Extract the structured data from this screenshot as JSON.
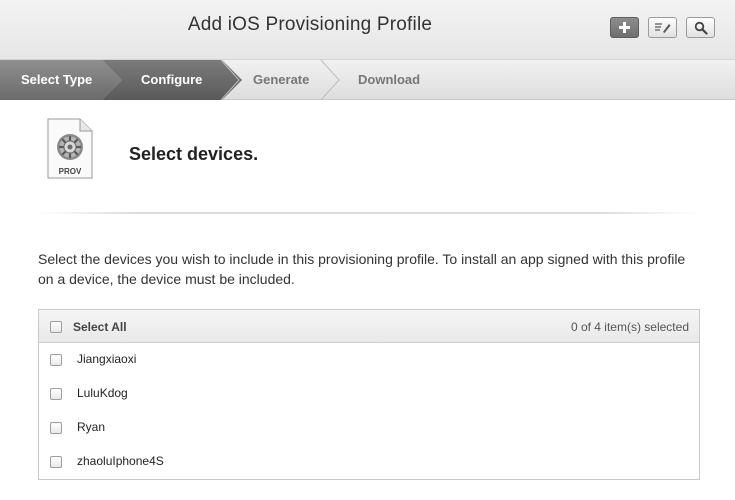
{
  "header": {
    "title": "Add iOS Provisioning Profile",
    "buttons": [
      {
        "icon": "plus-icon"
      },
      {
        "icon": "edit-icon"
      },
      {
        "icon": "search-icon"
      }
    ]
  },
  "steps": [
    {
      "label": "Select Type",
      "state": "completed"
    },
    {
      "label": "Configure",
      "state": "active"
    },
    {
      "label": "Generate",
      "state": "pending"
    },
    {
      "label": "Download",
      "state": "pending"
    }
  ],
  "section": {
    "icon_label": "PROV",
    "title": "Select devices.",
    "description": "Select the devices you wish to include in this provisioning profile. To install an app signed with this profile on a device, the device must be included."
  },
  "devices": {
    "select_all_label": "Select All",
    "selection_count": "0 of 4 item(s) selected",
    "items": [
      {
        "name": "Jiangxiaoxi",
        "checked": false
      },
      {
        "name": "LuluKdog",
        "checked": false
      },
      {
        "name": "Ryan",
        "checked": false
      },
      {
        "name": "zhaoluIphone4S",
        "checked": false
      }
    ]
  },
  "colors": {
    "active_step": "#5f5f5f",
    "completed_step": "#7d7d7d",
    "pending_step_text": "#777777"
  }
}
